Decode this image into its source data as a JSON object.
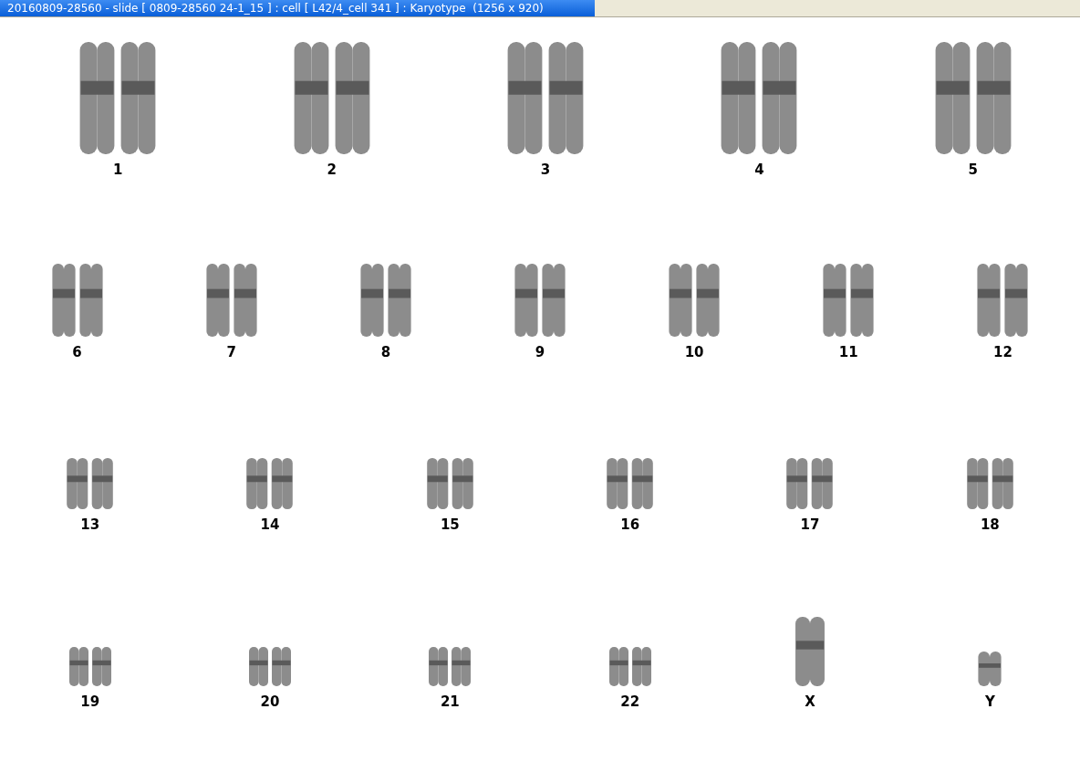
{
  "window": {
    "title": "20160809-28560 - slide [ 0809-28560 24-1_15 ] : cell [ L42/4_cell 341 ] : Karyotype  (1256 x 920)"
  },
  "karyotype": {
    "rows": [
      {
        "pairs": [
          {
            "label": "1"
          },
          {
            "label": "2"
          },
          {
            "label": "3"
          },
          {
            "label": "4"
          },
          {
            "label": "5"
          }
        ]
      },
      {
        "pairs": [
          {
            "label": "6"
          },
          {
            "label": "7"
          },
          {
            "label": "8"
          },
          {
            "label": "9"
          },
          {
            "label": "10"
          },
          {
            "label": "11"
          },
          {
            "label": "12"
          }
        ]
      },
      {
        "pairs": [
          {
            "label": "13"
          },
          {
            "label": "14"
          },
          {
            "label": "15"
          },
          {
            "label": "16"
          },
          {
            "label": "17"
          },
          {
            "label": "18"
          }
        ]
      },
      {
        "pairs": [
          {
            "label": "19"
          },
          {
            "label": "20"
          },
          {
            "label": "21"
          },
          {
            "label": "22"
          },
          {
            "label": "X"
          },
          {
            "label": "Y"
          }
        ]
      }
    ]
  }
}
